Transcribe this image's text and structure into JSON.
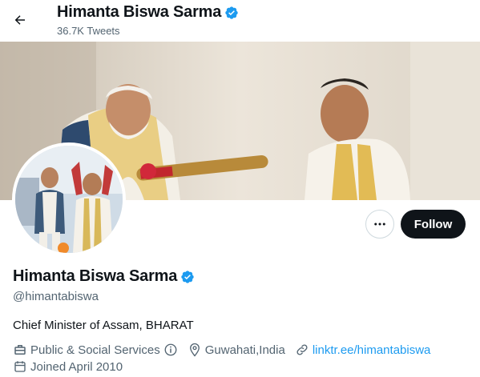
{
  "header": {
    "name": "Himanta Biswa Sarma",
    "tweet_count": "36.7K Tweets"
  },
  "profile": {
    "display_name": "Himanta Biswa Sarma",
    "handle": "@himantabiswa",
    "bio": "Chief Minister of Assam, BHARAT",
    "category": "Public & Social Services",
    "location": "Guwahati,India",
    "website": "linktr.ee/himantabiswa",
    "joined": "Joined April 2010",
    "verified": true
  },
  "actions": {
    "follow_label": "Follow"
  },
  "colors": {
    "accent": "#1d9bf0",
    "verified": "#1d9bf0",
    "follow_bg": "#0f1419",
    "secondary_text": "#536471"
  },
  "icons": {
    "back": "arrow-left-icon",
    "verified": "verified-badge-icon",
    "more": "more-horizontal-icon",
    "category": "briefcase-icon",
    "info": "info-icon",
    "location": "location-pin-icon",
    "link": "link-icon",
    "calendar": "calendar-icon"
  }
}
